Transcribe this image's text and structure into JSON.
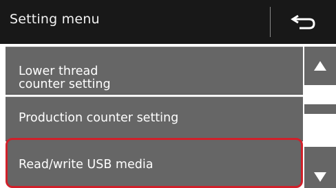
{
  "header": {
    "title": "Setting menu",
    "back_icon": "return-arrow-icon"
  },
  "menu": {
    "items": [
      {
        "label_line1": "Lower thread",
        "label_line2": "counter setting"
      },
      {
        "label": "Production counter setting"
      },
      {
        "label": "Read/write USB media",
        "highlighted": true
      }
    ]
  },
  "scrollbar": {
    "up_icon": "triangle-up-icon",
    "down_icon": "triangle-down-icon"
  },
  "colors": {
    "header_bg": "#181818",
    "item_bg": "#666666",
    "highlight_border": "#d0202a",
    "text": "#ffffff"
  }
}
